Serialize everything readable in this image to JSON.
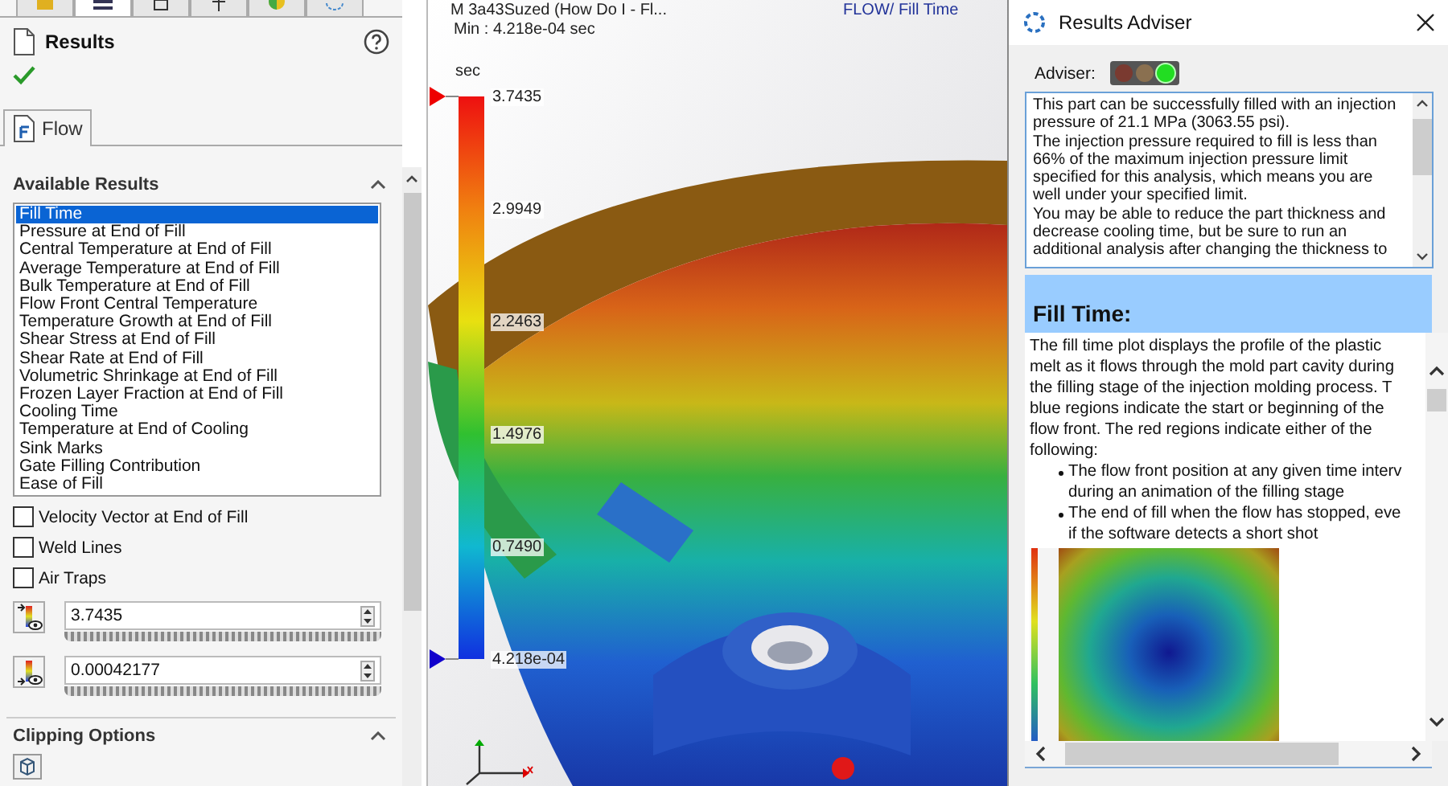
{
  "sidebar": {
    "top_tabs": [
      {
        "selected": false
      },
      {
        "selected": true
      },
      {
        "selected": false
      },
      {
        "selected": false
      },
      {
        "selected": false
      },
      {
        "selected": false
      }
    ],
    "title": "Results",
    "flow_tab": {
      "label": "Flow",
      "selected": true
    },
    "available_results": {
      "title": "Available Results",
      "expanded": true,
      "items": [
        {
          "label": "Fill Time",
          "selected": true
        },
        {
          "label": "Pressure at End of Fill",
          "selected": false
        },
        {
          "label": "Central Temperature at End of Fill",
          "selected": false
        },
        {
          "label": "Average Temperature at End of Fill",
          "selected": false
        },
        {
          "label": "Bulk Temperature at End of Fill",
          "selected": false
        },
        {
          "label": "Flow Front Central Temperature",
          "selected": false
        },
        {
          "label": "Temperature Growth at End of Fill",
          "selected": false
        },
        {
          "label": "Shear Stress at End of Fill",
          "selected": false
        },
        {
          "label": "Shear Rate at End of Fill",
          "selected": false
        },
        {
          "label": "Volumetric Shrinkage at End of Fill",
          "selected": false
        },
        {
          "label": "Frozen Layer Fraction at End of Fill",
          "selected": false
        },
        {
          "label": "Cooling Time",
          "selected": false
        },
        {
          "label": "Temperature at End of Cooling",
          "selected": false
        },
        {
          "label": "Sink Marks",
          "selected": false
        },
        {
          "label": "Gate Filling Contribution",
          "selected": false
        },
        {
          "label": "Ease of Fill",
          "selected": false
        }
      ]
    },
    "options": [
      {
        "label": "Velocity Vector at End of Fill",
        "checked": false
      },
      {
        "label": "Weld Lines",
        "checked": false
      },
      {
        "label": "Air Traps",
        "checked": false
      }
    ],
    "limits": [
      {
        "kind": "max",
        "value": "3.7435",
        "level": 1
      },
      {
        "kind": "min",
        "value": "0.00042177",
        "level": 1
      }
    ],
    "clipping": {
      "title": "Clipping Options",
      "expanded": true
    }
  },
  "viewport": {
    "model_line": "M  3a43Suzed  (How Do I - Fl...",
    "min_line": "Min : 4.218e-04 sec",
    "plot_title": "FLOW/ Fill Time",
    "legend": {
      "unit": "sec",
      "labels": [
        "3.7435",
        "2.9949",
        "2.2463",
        "1.4976",
        "0.7490",
        "4.218e-04"
      ]
    }
  },
  "adviser": {
    "title": "Results Adviser",
    "label": "Adviser:",
    "lights": [
      {
        "color": "#7a3a30",
        "on": false
      },
      {
        "color": "#8a7050",
        "on": false
      },
      {
        "color": "#22dd22",
        "on": true
      }
    ],
    "message": [
      "This part can be successfully filled with an injection",
      "pressure of 21.1 MPa (3063.55 psi).",
      "The injection pressure required to fill is less than",
      "66% of the maximum injection pressure limit",
      "specified for this analysis, which means you are",
      "well under your specified limit.",
      "You may be able to reduce the part thickness and",
      "decrease cooling time, but be sure to run an",
      "additional analysis after changing the thickness to"
    ],
    "section_title": "Fill Time:",
    "help": {
      "paragraph": [
        "The fill time plot displays the profile of the plastic",
        "melt as it flows through the mold part cavity during",
        "the filling stage of the injection molding process. T",
        "blue regions indicate the start or beginning of the",
        "flow front. The red regions indicate either of the",
        "following:"
      ],
      "bullets": [
        [
          "The flow front position at any given time interv",
          "during an animation of the filling stage"
        ],
        [
          "The end of fill when the flow has stopped, eve",
          "if the software detects a short shot"
        ]
      ]
    }
  }
}
